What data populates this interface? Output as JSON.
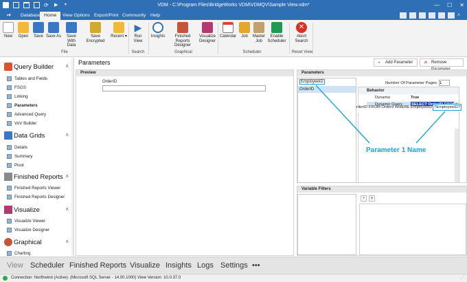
{
  "window": {
    "title": "VDM - C:\\Program Files\\BridgeWorks VDM\\VDMQV\\Sample View.vdm*",
    "controls": {
      "minimize": "—",
      "maximize": "☐",
      "close": "✕"
    }
  },
  "menu_tabs": [
    "Database",
    "Home",
    "View Options",
    "Export/Print",
    "Community",
    "Help"
  ],
  "active_tab": "Home",
  "ribbon": {
    "buttons": [
      {
        "label": "New",
        "icon": "new-file-icon",
        "color": "#f4f4f4"
      },
      {
        "label": "Open",
        "icon": "open-folder-icon",
        "color": "#f0b93a"
      },
      {
        "label": "Save",
        "icon": "save-icon",
        "color": "#3a78c3"
      },
      {
        "label": "Save As",
        "icon": "save-as-icon",
        "color": "#3a78c3"
      },
      {
        "label": "Save With Data",
        "icon": "save-with-data-icon",
        "color": "#3a78c3"
      },
      {
        "label": "Save Encrypted",
        "icon": "save-encrypted-icon",
        "color": "#d4a82a"
      },
      {
        "label": "Recent ▾",
        "icon": "recent-icon",
        "color": "#f0b93a"
      },
      {
        "label": "Run View",
        "icon": "run-view-icon",
        "color": "#2f6fb5"
      },
      {
        "label": "Insights",
        "icon": "insights-icon",
        "color": "#2f6fb5"
      },
      {
        "label": "Finished Reports Designer",
        "icon": "finished-reports-designer-icon",
        "color": "#c4553b"
      },
      {
        "label": "Visualize Designer",
        "icon": "visualize-designer-icon",
        "color": "#b23a6e"
      },
      {
        "label": "Calendar",
        "icon": "calendar-icon",
        "color": "#ffffff"
      },
      {
        "label": "Job",
        "icon": "job-icon",
        "color": "#e6a52c"
      },
      {
        "label": "Master Job",
        "icon": "master-job-icon",
        "color": "#c0a16e"
      },
      {
        "label": "Enable Scheduler",
        "icon": "enable-scheduler-icon",
        "color": "#1f9a52"
      },
      {
        "label": "Abort Search",
        "icon": "abort-search-icon",
        "color": "#d93025"
      }
    ],
    "groups": [
      "File",
      "Search",
      "Graphical",
      "Scheduler",
      "Reset View"
    ]
  },
  "sidebar": {
    "sections": [
      {
        "label": "Query Builder",
        "icon": "query-builder-icon",
        "items": [
          "Tables and Fields",
          "FSGS",
          "Linking",
          "Parameters",
          "Advanced Query",
          "VoV Builder"
        ]
      },
      {
        "label": "Data Grids",
        "icon": "data-grids-icon",
        "items": [
          "Details",
          "Summary",
          "Pivot"
        ]
      },
      {
        "label": "Finished Reports",
        "icon": "finished-reports-icon",
        "items": [
          "Finished Reports Viewer",
          "Finished Reports Designer"
        ]
      },
      {
        "label": "Visualize",
        "icon": "visualize-icon",
        "items": [
          "Visualize Viewer",
          "Visualize Designer"
        ]
      },
      {
        "label": "Graphical",
        "icon": "graphical-icon",
        "items": [
          "Charting"
        ]
      }
    ],
    "active_item": "Parameters"
  },
  "main": {
    "page_title": "Parameters",
    "add_parameter": "Add Parameter",
    "remove_parameter": "Remove Parameter",
    "preview": {
      "header": "Preview",
      "field_label": "OrderID",
      "field_value": ""
    },
    "parameters": {
      "header": "Parameters",
      "list": [
        "EmployeeID",
        "OrderID"
      ],
      "pages_label": "Number Of Parameter Pages",
      "pages_value": "1",
      "properties_title": "Behavior",
      "prop_rows": [
        {
          "name": "Dynamic",
          "value": "True"
        },
        {
          "name": "Dynamic Query",
          "value": "SELECT OrderID FROM"
        }
      ],
      "query_text": "rderID FROM Orders WHERE EmployeeID IN",
      "query_token": "?EmployeeID?",
      "annotation": "Parameter 1 Name"
    },
    "variable_filters": {
      "header": "Variable Filters",
      "add": "+",
      "remove": "✕"
    }
  },
  "bottom_nav": [
    "View",
    "Scheduler",
    "Finished Reports",
    "Visualize",
    "Insights",
    "Logs",
    "Settings",
    "•••"
  ],
  "status": {
    "text": "Connection: Northwind (Active): (Microsoft SQL Server - 14.00.1000) View Version: 10.0.37.0"
  },
  "colors": {
    "accent": "#2f6fb5",
    "annotation": "#1aa3d6",
    "bottom_nav_bg": "#e4e4e4"
  }
}
